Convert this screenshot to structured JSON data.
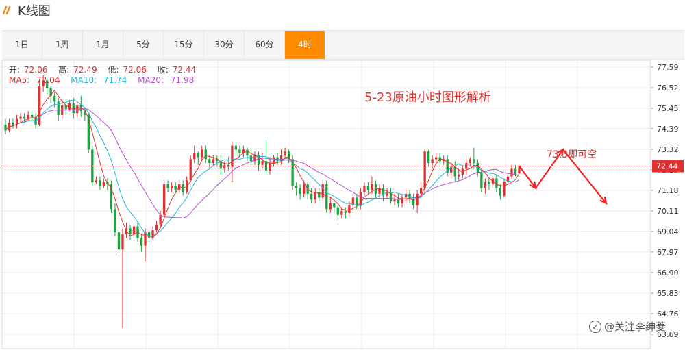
{
  "header": {
    "title": "K线图",
    "logo_icon": "double-slash-logo-icon"
  },
  "tabs": [
    {
      "label": "1日"
    },
    {
      "label": "1周"
    },
    {
      "label": "1月"
    },
    {
      "label": "5分"
    },
    {
      "label": "15分"
    },
    {
      "label": "30分"
    },
    {
      "label": "60分"
    },
    {
      "label": "4时",
      "active": true
    }
  ],
  "ohlc": {
    "open_label": "开:",
    "open": "72.06",
    "high_label": "高:",
    "high": "72.49",
    "low_label": "低:",
    "low": "72.06",
    "close_label": "收:",
    "close": "72.44"
  },
  "ma": {
    "ma5_label": "MA5:",
    "ma5": "72.04",
    "ma10_label": "MA10:",
    "ma10": "71.74",
    "ma20_label": "MA20:",
    "ma20": "71.98"
  },
  "annotation": {
    "title": "5-23原油小时图形解析",
    "forecast_label": "73.3即可空"
  },
  "watermark": "@关注李绅菱",
  "colors": {
    "up": "#e0302f",
    "down": "#19a53e",
    "accent": "#ff8c00",
    "ma5": "#e0302f",
    "ma10": "#21b6d6",
    "ma20": "#b44fd1"
  },
  "chart_data": {
    "type": "candlestick",
    "y_ticks": [
      "77.59",
      "76.52",
      "75.45",
      "74.39",
      "73.32",
      "72.25",
      "71.18",
      "70.11",
      "69.04",
      "67.97",
      "66.90",
      "65.83",
      "64.76",
      "63.69"
    ],
    "ylim": [
      63.69,
      77.59
    ],
    "current_price": "72.44",
    "forecast_path": [
      72.44,
      71.3,
      73.3,
      70.5
    ],
    "candles": [
      [
        74.6,
        74.3,
        74.9,
        74.1
      ],
      [
        74.3,
        74.7,
        74.9,
        74.2
      ],
      [
        74.7,
        74.6,
        74.9,
        74.4
      ],
      [
        74.6,
        74.9,
        75.1,
        74.4
      ],
      [
        74.9,
        75.0,
        75.2,
        74.7
      ],
      [
        75.0,
        74.9,
        75.2,
        74.7
      ],
      [
        74.9,
        75.1,
        75.3,
        74.8
      ],
      [
        75.1,
        75.0,
        75.3,
        74.8
      ],
      [
        75.0,
        74.6,
        75.2,
        74.4
      ],
      [
        74.6,
        76.6,
        76.9,
        74.5
      ],
      [
        76.6,
        76.9,
        77.2,
        76.3
      ],
      [
        76.9,
        76.5,
        77.0,
        76.2
      ],
      [
        76.5,
        76.1,
        76.6,
        75.7
      ],
      [
        76.1,
        75.8,
        76.3,
        75.5
      ],
      [
        75.8,
        75.1,
        76.0,
        74.8
      ],
      [
        75.1,
        75.6,
        75.9,
        74.9
      ],
      [
        75.6,
        75.4,
        75.9,
        75.1
      ],
      [
        75.4,
        75.7,
        75.9,
        75.3
      ],
      [
        75.7,
        75.2,
        76.0,
        74.9
      ],
      [
        75.2,
        75.6,
        75.8,
        75.0
      ],
      [
        75.6,
        75.3,
        76.1,
        75.0
      ],
      [
        75.3,
        75.1,
        75.5,
        74.8
      ],
      [
        75.1,
        73.3,
        75.2,
        73.1
      ],
      [
        73.3,
        71.6,
        73.5,
        71.4
      ],
      [
        71.6,
        71.7,
        71.9,
        71.5
      ],
      [
        71.7,
        71.4,
        71.9,
        71.2
      ],
      [
        71.4,
        71.6,
        71.8,
        71.3
      ],
      [
        71.6,
        71.5,
        71.8,
        71.2
      ],
      [
        71.5,
        70.2,
        71.7,
        70.0
      ],
      [
        70.2,
        69.0,
        70.5,
        68.8
      ],
      [
        69.0,
        68.1,
        69.3,
        67.9
      ],
      [
        68.1,
        68.9,
        69.2,
        64.0
      ],
      [
        68.9,
        69.2,
        69.5,
        68.7
      ],
      [
        69.2,
        68.9,
        69.4,
        68.6
      ],
      [
        68.9,
        69.3,
        69.5,
        68.7
      ],
      [
        69.3,
        68.7,
        69.5,
        68.5
      ],
      [
        68.7,
        68.3,
        68.9,
        68.0
      ],
      [
        68.3,
        69.0,
        69.2,
        67.5
      ],
      [
        69.0,
        68.7,
        69.3,
        68.5
      ],
      [
        68.7,
        69.1,
        69.3,
        68.6
      ],
      [
        69.1,
        69.4,
        69.6,
        69.0
      ],
      [
        69.4,
        69.9,
        70.1,
        69.2
      ],
      [
        69.9,
        71.5,
        71.7,
        69.8
      ],
      [
        71.5,
        71.3,
        71.7,
        71.1
      ],
      [
        71.3,
        71.4,
        71.6,
        71.1
      ],
      [
        71.4,
        71.2,
        71.6,
        71.0
      ],
      [
        71.2,
        71.5,
        71.7,
        71.0
      ],
      [
        71.5,
        71.1,
        71.7,
        70.9
      ],
      [
        71.1,
        71.7,
        71.9,
        71.0
      ],
      [
        71.7,
        72.8,
        73.0,
        71.6
      ],
      [
        72.8,
        73.1,
        73.5,
        72.6
      ],
      [
        73.1,
        72.9,
        73.2,
        72.5
      ],
      [
        72.9,
        73.3,
        73.5,
        72.7
      ],
      [
        73.3,
        72.8,
        73.5,
        72.6
      ],
      [
        72.8,
        72.6,
        73.0,
        72.3
      ],
      [
        72.6,
        72.8,
        73.0,
        72.4
      ],
      [
        72.8,
        72.7,
        73.0,
        72.4
      ],
      [
        72.7,
        72.3,
        73.0,
        72.0
      ],
      [
        72.3,
        72.5,
        72.7,
        72.1
      ],
      [
        72.5,
        72.4,
        72.9,
        72.2
      ],
      [
        72.4,
        73.5,
        73.7,
        71.6
      ],
      [
        73.5,
        73.3,
        73.6,
        73.0
      ],
      [
        73.3,
        73.1,
        73.5,
        72.9
      ],
      [
        73.1,
        73.3,
        73.5,
        72.9
      ],
      [
        73.3,
        73.0,
        73.4,
        72.7
      ],
      [
        73.0,
        72.7,
        73.3,
        72.5
      ],
      [
        72.7,
        73.0,
        73.2,
        72.5
      ],
      [
        73.0,
        72.5,
        73.2,
        72.2
      ],
      [
        72.5,
        72.7,
        73.1,
        72.3
      ],
      [
        72.7,
        72.2,
        73.8,
        72.0
      ],
      [
        72.2,
        72.6,
        72.9,
        72.0
      ],
      [
        72.6,
        72.9,
        73.0,
        72.4
      ],
      [
        72.9,
        72.7,
        73.1,
        72.5
      ],
      [
        72.7,
        73.0,
        73.3,
        72.5
      ],
      [
        73.0,
        73.2,
        73.4,
        72.9
      ],
      [
        73.2,
        72.8,
        73.3,
        72.6
      ],
      [
        72.8,
        71.4,
        73.0,
        71.2
      ],
      [
        71.4,
        71.3,
        71.6,
        70.9
      ],
      [
        71.3,
        71.0,
        71.5,
        70.7
      ],
      [
        71.0,
        71.5,
        71.7,
        70.8
      ],
      [
        71.5,
        71.0,
        71.6,
        70.7
      ],
      [
        71.0,
        70.7,
        71.3,
        70.5
      ],
      [
        70.7,
        71.1,
        71.3,
        70.5
      ],
      [
        71.1,
        70.8,
        71.3,
        70.6
      ],
      [
        70.8,
        71.5,
        71.7,
        70.6
      ],
      [
        71.5,
        70.2,
        71.7,
        70.0
      ],
      [
        70.2,
        70.5,
        70.8,
        70.0
      ],
      [
        70.5,
        70.3,
        70.7,
        70.0
      ],
      [
        70.3,
        69.9,
        70.5,
        69.6
      ],
      [
        69.9,
        70.1,
        70.3,
        69.7
      ],
      [
        70.1,
        70.0,
        70.3,
        69.7
      ],
      [
        70.0,
        70.4,
        70.6,
        69.8
      ],
      [
        70.4,
        70.8,
        71.0,
        70.2
      ],
      [
        70.8,
        70.4,
        71.0,
        70.2
      ],
      [
        70.4,
        71.1,
        71.3,
        70.2
      ],
      [
        71.1,
        71.4,
        71.6,
        70.9
      ],
      [
        71.4,
        71.2,
        71.6,
        71.0
      ],
      [
        71.2,
        71.5,
        71.9,
        71.0
      ],
      [
        71.5,
        71.0,
        71.7,
        70.8
      ],
      [
        71.0,
        71.3,
        71.5,
        70.8
      ],
      [
        71.3,
        70.9,
        71.5,
        70.6
      ],
      [
        70.9,
        71.1,
        71.3,
        70.8
      ],
      [
        71.1,
        70.6,
        71.3,
        70.5
      ],
      [
        70.6,
        70.7,
        71.0,
        70.4
      ],
      [
        70.7,
        70.5,
        71.0,
        70.3
      ],
      [
        70.5,
        70.8,
        71.0,
        70.3
      ],
      [
        70.8,
        71.0,
        71.2,
        70.5
      ],
      [
        71.0,
        70.7,
        71.2,
        70.5
      ],
      [
        70.7,
        70.4,
        71.0,
        70.2
      ],
      [
        70.4,
        71.0,
        71.2,
        70.0
      ],
      [
        71.0,
        71.3,
        71.6,
        70.8
      ],
      [
        71.3,
        73.2,
        73.3,
        71.0
      ],
      [
        73.2,
        72.6,
        73.3,
        72.4
      ],
      [
        72.6,
        72.8,
        73.0,
        72.3
      ],
      [
        72.8,
        72.9,
        73.1,
        72.6
      ],
      [
        72.9,
        72.7,
        73.1,
        72.4
      ],
      [
        72.7,
        72.8,
        73.0,
        72.5
      ],
      [
        72.8,
        72.1,
        73.0,
        71.9
      ],
      [
        72.1,
        72.4,
        72.6,
        71.8
      ],
      [
        72.4,
        71.9,
        72.7,
        71.6
      ],
      [
        71.9,
        72.0,
        72.3,
        71.7
      ],
      [
        72.0,
        72.3,
        72.5,
        71.8
      ],
      [
        72.3,
        72.6,
        72.8,
        72.0
      ],
      [
        72.6,
        72.8,
        72.9,
        72.4
      ],
      [
        72.8,
        72.6,
        73.4,
        72.3
      ],
      [
        72.6,
        72.1,
        72.8,
        71.9
      ],
      [
        72.1,
        71.3,
        72.3,
        71.1
      ],
      [
        71.3,
        71.6,
        71.8,
        71.0
      ],
      [
        71.6,
        71.5,
        71.8,
        71.2
      ],
      [
        71.5,
        71.8,
        72.0,
        71.3
      ],
      [
        71.8,
        71.3,
        72.0,
        71.1
      ],
      [
        71.3,
        70.9,
        71.5,
        70.7
      ],
      [
        70.9,
        71.6,
        71.8,
        70.8
      ],
      [
        71.6,
        71.9,
        72.1,
        71.4
      ],
      [
        71.9,
        72.3,
        72.5,
        71.8
      ],
      [
        72.3,
        72.0,
        72.5,
        71.9
      ],
      [
        72.06,
        72.44,
        72.49,
        72.06
      ]
    ]
  }
}
